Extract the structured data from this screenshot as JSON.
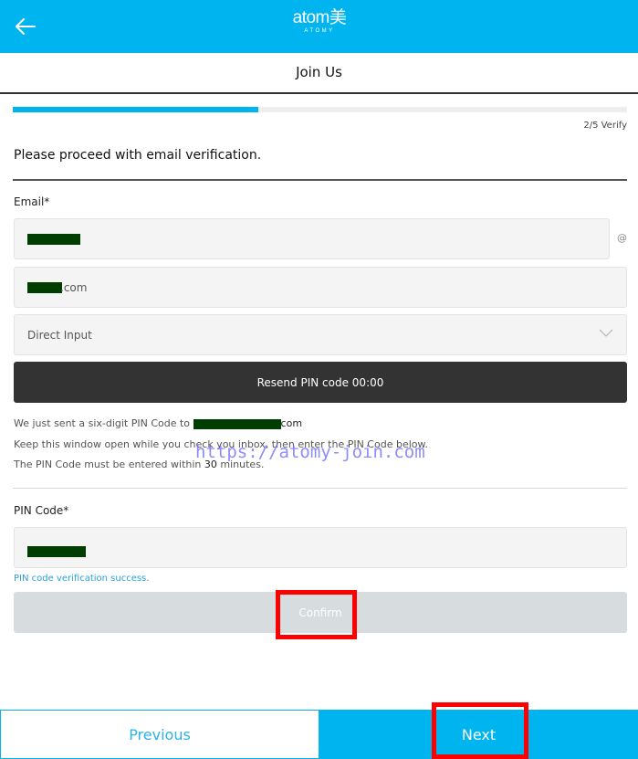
{
  "header": {
    "back_icon": "arrow-left-icon",
    "logo_text": "atom美",
    "logo_subtext": "ATOMY",
    "brand_color": "#00b5ef"
  },
  "page": {
    "title": "Join Us",
    "progress": {
      "current_step": 2,
      "total_steps": 5,
      "fraction": 0.4,
      "label": "2/5 Verify"
    },
    "heading": "Please proceed with email verification."
  },
  "email": {
    "label": "Email*",
    "local_part_value": "[redacted]",
    "at_symbol": "@",
    "domain_value_suffix": "com",
    "domain_select": {
      "selected": "Direct Input",
      "icon": "chevron-down-icon"
    },
    "resend_button": {
      "label": "Resend PIN code",
      "timer": "00:00"
    }
  },
  "info": {
    "line1_prefix": "We just sent a six-digit PIN Code to",
    "line1_suffix": "com",
    "line2": "Keep this window open while you check you inbox, then enter the PIN Code below.",
    "line3_prefix": "The PIN Code must be entered within",
    "line3_minutes": "30",
    "line3_suffix": "minutes."
  },
  "pin": {
    "label": "PIN Code*",
    "value": "[redacted]",
    "status_message": "PIN code verification success.",
    "confirm_label": "Confirm"
  },
  "footer": {
    "previous_label": "Previous",
    "next_label": "Next"
  },
  "overlay": {
    "watermark": "https://atomy-join.com",
    "highlight_color": "#ff0000"
  }
}
